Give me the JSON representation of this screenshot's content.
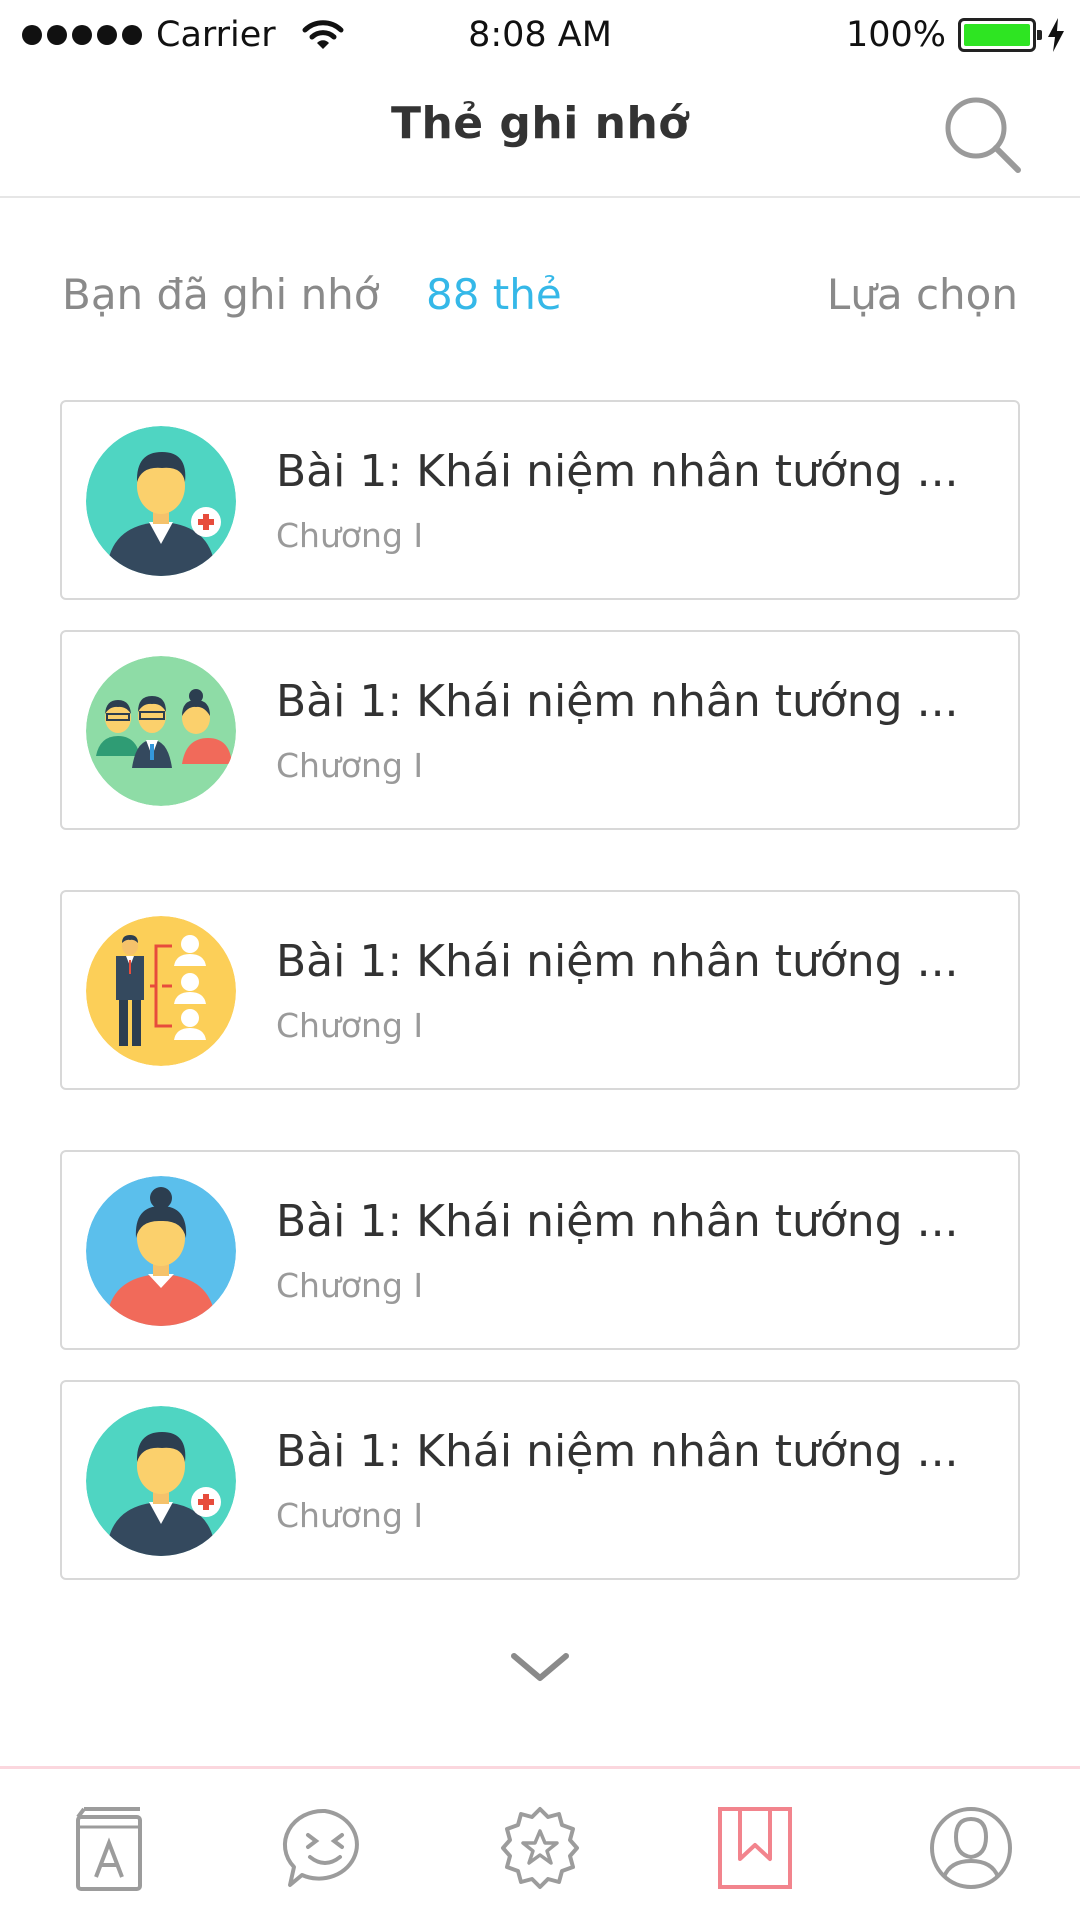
{
  "status_bar": {
    "carrier": "Carrier",
    "time": "8:08 AM",
    "battery_percent": "100%",
    "battery_level": 1.0
  },
  "header": {
    "title": "Thẻ ghi nhớ",
    "search_icon": "search-icon"
  },
  "summary": {
    "label": "Bạn đã ghi nhớ",
    "count": "88 thẻ",
    "select_label": "Lựa chọn"
  },
  "cards": [
    {
      "title": "Bài 1: Khái niệm nhân tướng ...",
      "subtitle": "Chương I",
      "icon": "doctor-avatar-icon",
      "color": "#4fd5c2"
    },
    {
      "title": "Bài 1: Khái niệm nhân tướng ...",
      "subtitle": "Chương I",
      "icon": "group-avatar-icon",
      "color": "#8edca6"
    },
    {
      "title": "Bài 1: Khái niệm nhân tướng ...",
      "subtitle": "Chương I",
      "icon": "org-chart-avatar-icon",
      "color": "#fccf58"
    },
    {
      "title": "Bài 1: Khái niệm nhân tướng ...",
      "subtitle": "Chương I",
      "icon": "woman-avatar-icon",
      "color": "#5bbfec"
    },
    {
      "title": "Bài 1: Khái niệm nhân tướng ...",
      "subtitle": "Chương I",
      "icon": "doctor-avatar-icon",
      "color": "#4fd5c2"
    }
  ],
  "tab_bar": {
    "items": [
      {
        "icon": "dictionary-book-icon",
        "active": false
      },
      {
        "icon": "chat-emoji-icon",
        "active": false
      },
      {
        "icon": "star-badge-icon",
        "active": false
      },
      {
        "icon": "bookmark-icon",
        "active": true
      },
      {
        "icon": "profile-icon",
        "active": false
      }
    ]
  },
  "colors": {
    "accent": "#35b8e8",
    "active_tab": "#f2848d",
    "inactive_tab": "#9c9c9c"
  }
}
